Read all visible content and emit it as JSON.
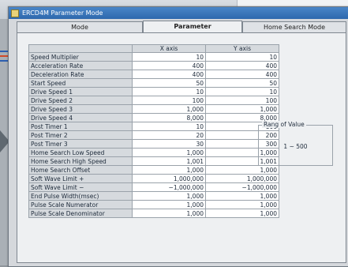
{
  "window": {
    "title": "ERCD4M Parameter Mode"
  },
  "tabs": [
    {
      "label": "Mode",
      "active": false
    },
    {
      "label": "Parameter",
      "active": true
    },
    {
      "label": "Home Search Mode",
      "active": false
    }
  ],
  "table": {
    "columns": [
      "X axis",
      "Y axis"
    ],
    "rows": [
      {
        "label": "Speed Multiplier",
        "x": "10",
        "y": "10"
      },
      {
        "label": "Acceleration Rate",
        "x": "400",
        "y": "400"
      },
      {
        "label": "Deceleration Rate",
        "x": "400",
        "y": "400"
      },
      {
        "label": "Start Speed",
        "x": "50",
        "y": "50"
      },
      {
        "label": "Drive Speed 1",
        "x": "10",
        "y": "10"
      },
      {
        "label": "Drive Speed 2",
        "x": "100",
        "y": "100"
      },
      {
        "label": "Drive Speed 3",
        "x": "1,000",
        "y": "1,000"
      },
      {
        "label": "Drive Speed 4",
        "x": "8,000",
        "y": "8,000"
      },
      {
        "label": "Post Timer 1",
        "x": "10",
        "y": "100"
      },
      {
        "label": "Post Timer 2",
        "x": "20",
        "y": "200"
      },
      {
        "label": "Post Timer 3",
        "x": "30",
        "y": "300"
      },
      {
        "label": "Home Search Low Speed",
        "x": "1,000",
        "y": "1,000"
      },
      {
        "label": "Home Search High Speed",
        "x": "1,001",
        "y": "1,001"
      },
      {
        "label": "Home Search Offset",
        "x": "1,000",
        "y": "1,000"
      },
      {
        "label": "Soft Wave Limit +",
        "x": "1,000,000",
        "y": "1,000,000"
      },
      {
        "label": "Soft Wave Limit −",
        "x": "−1,000,000",
        "y": "−1,000,000"
      },
      {
        "label": "End Pulse Width(msec)",
        "x": "1,000",
        "y": "1,000"
      },
      {
        "label": "Pulse Scale Numerator",
        "x": "1,000",
        "y": "1,000"
      },
      {
        "label": "Pulse Scale Denominator",
        "x": "1,000",
        "y": "1,000"
      }
    ]
  },
  "range": {
    "legend": "Rang of Value",
    "value": "1 ~ 500"
  },
  "colors": {
    "titlebar": "#2d68ad",
    "panel": "#eef0f2",
    "header_cell": "#d6dade"
  },
  "icons": {
    "app": "app-icon",
    "arrow": "arrow-right-icon"
  }
}
